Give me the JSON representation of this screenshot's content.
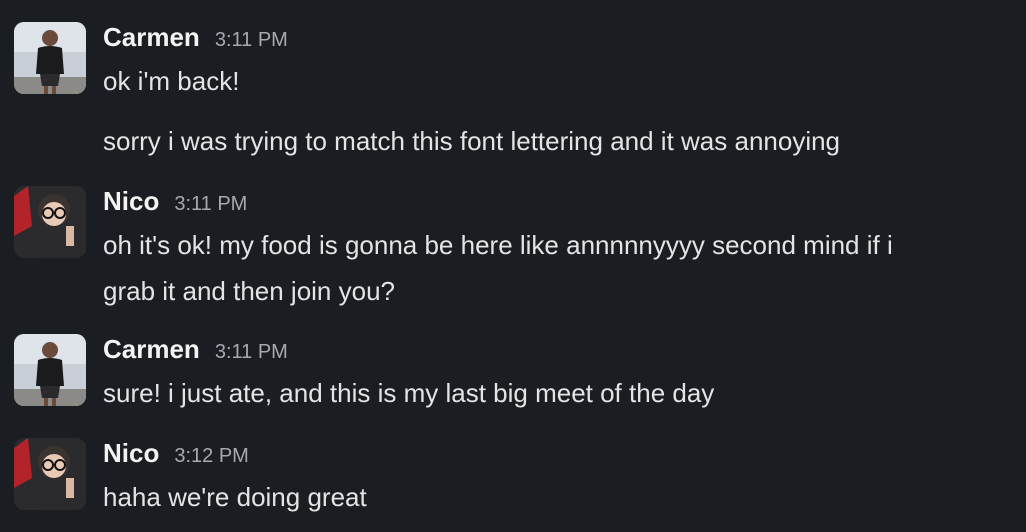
{
  "messages": [
    {
      "author": "Carmen",
      "time": "3:11 PM",
      "avatar_icon": "person-avatar",
      "lines": [
        "ok i'm back!",
        "sorry i was trying to match this font lettering and it was annoying"
      ]
    },
    {
      "author": "Nico",
      "time": "3:11 PM",
      "avatar_icon": "person-avatar",
      "lines": [
        "oh it's ok! my food is gonna be here like annnnnyyyy second mind if i",
        "grab it and then join you?"
      ]
    },
    {
      "author": "Carmen",
      "time": "3:11 PM",
      "avatar_icon": "person-avatar",
      "lines": [
        "sure! i just ate, and this is my last big meet of the day"
      ]
    },
    {
      "author": "Nico",
      "time": "3:12 PM",
      "avatar_icon": "person-avatar",
      "lines": [
        "haha we're doing great"
      ]
    }
  ],
  "colors": {
    "background": "#1a1d21",
    "name": "#f3f3f3",
    "timestamp": "#a9a9ab",
    "text": "#e4e4e5"
  }
}
